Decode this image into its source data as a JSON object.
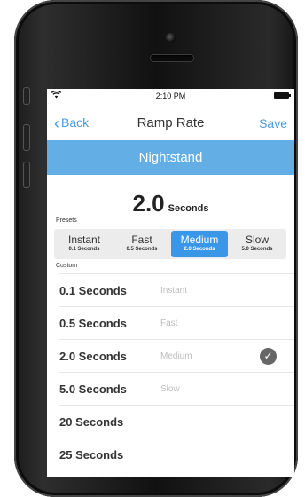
{
  "status_bar": {
    "time": "2:10 PM"
  },
  "nav": {
    "back_label": "Back",
    "title": "Ramp Rate",
    "save_label": "Save"
  },
  "device": {
    "name": "Nightstand"
  },
  "current": {
    "value": "2.0",
    "unit": "Seconds"
  },
  "presets": {
    "label": "Presets",
    "items": [
      {
        "name": "Instant",
        "time": "0.1 Seconds"
      },
      {
        "name": "Fast",
        "time": "0.5 Seconds"
      },
      {
        "name": "Medium",
        "time": "2.0 Seconds"
      },
      {
        "name": "Slow",
        "time": "5.0 Seconds"
      }
    ],
    "selected": "Medium"
  },
  "custom": {
    "label": "Custom",
    "rows": [
      {
        "value": "0.1 Seconds",
        "name": "Instant"
      },
      {
        "value": "0.5 Seconds",
        "name": "Fast"
      },
      {
        "value": "2.0 Seconds",
        "name": "Medium"
      },
      {
        "value": "5.0 Seconds",
        "name": "Slow"
      },
      {
        "value": "20 Seconds",
        "name": ""
      },
      {
        "value": "25 Seconds",
        "name": ""
      }
    ],
    "selected": "2.0 Seconds"
  },
  "icons": {
    "status": [
      "wifi-icon",
      "battery-icon"
    ],
    "nav": [
      "chevron-left-icon"
    ],
    "list": [
      "checkmark-icon"
    ]
  },
  "colors": {
    "accent": "#4a9be0",
    "banner": "#63aee4",
    "segment_active": "#3a97e8"
  }
}
